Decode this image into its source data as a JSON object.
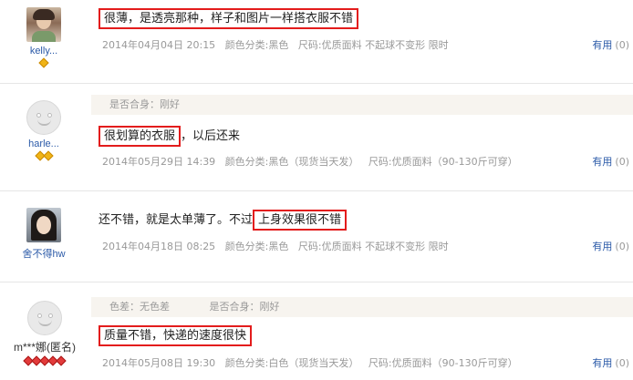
{
  "reviews": [
    {
      "user": "kelly...",
      "content_boxed": "很薄，是透亮那种，样子和图片一样搭衣服不错",
      "date": "2014年04月04日 20:15",
      "color": "颜色分类:黑色",
      "size": "尺码:优质面料 不起球不变形 限时",
      "useful_label": "有用",
      "useful_count": "(0)"
    },
    {
      "user": "harle...",
      "fit": "是否合身：刚好",
      "content_boxed": "很划算的衣服",
      "content_rest": "，以后还来",
      "date": "2014年05月29日 14:39",
      "color": "颜色分类:黑色（现货当天发）",
      "size": "尺码:优质面料（90-130斤可穿）",
      "useful_label": "有用",
      "useful_count": "(0)"
    },
    {
      "user": "舍不得hw",
      "content_pre": "还不错，就是太单薄了。不过",
      "content_boxed": "上身效果很不错",
      "date": "2014年04月18日 08:25",
      "color": "颜色分类:黑色",
      "size": "尺码:优质面料 不起球不变形 限时",
      "useful_label": "有用",
      "useful_count": "(0)"
    },
    {
      "user": "m***娜(匿名)",
      "colordiff": "色差：无色差",
      "fit": "是否合身：刚好",
      "content_boxed": "质量不错，快递的速度很快",
      "date": "2014年05月08日 19:30",
      "color": "颜色分类:白色（现货当天发）",
      "size": "尺码:优质面料（90-130斤可穿）",
      "useful_label": "有用",
      "useful_count": "(0)"
    }
  ],
  "colors": {
    "highlight_border": "#e31c1c",
    "link": "#2b5aa8",
    "meta": "#999999",
    "gold_badge": "#f0b416",
    "red_badge": "#e23b3b"
  },
  "icons": {
    "avatar_placeholder": "smiley-face-placeholder",
    "badge": "diamond-icon"
  }
}
